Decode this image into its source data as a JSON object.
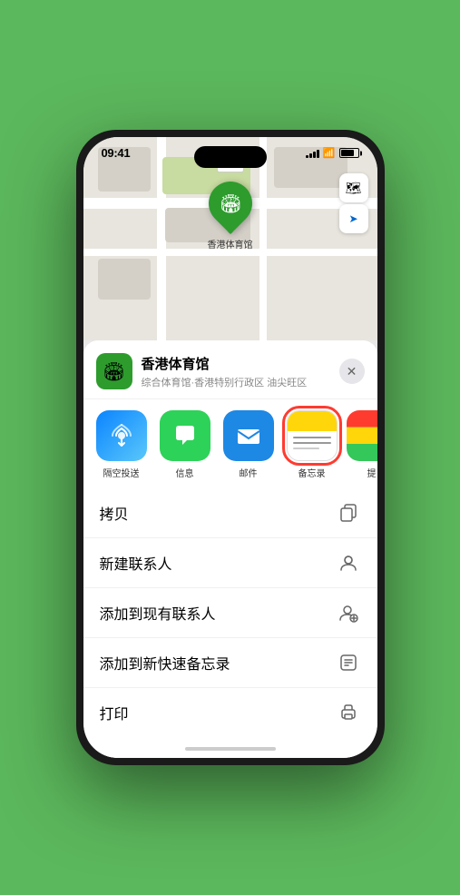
{
  "status": {
    "time": "09:41",
    "signal_bars": [
      3,
      5,
      7,
      9,
      11
    ],
    "wifi": "wifi",
    "battery": 80
  },
  "map": {
    "label": "南口",
    "pin_label": "香港体育馆",
    "map_icon": "🏟"
  },
  "map_controls": {
    "map_btn_label": "🗺",
    "location_btn_label": "➤"
  },
  "venue": {
    "name": "香港体育馆",
    "description": "综合体育馆·香港特别行政区 油尖旺区",
    "icon": "🏟",
    "close_label": "✕"
  },
  "share_items": [
    {
      "id": "airdrop",
      "label": "隔空投送",
      "icon": "📡"
    },
    {
      "id": "messages",
      "label": "信息",
      "icon": "💬"
    },
    {
      "id": "mail",
      "label": "邮件",
      "icon": "✉"
    },
    {
      "id": "notes",
      "label": "备忘录",
      "icon": "📝"
    },
    {
      "id": "more",
      "label": "提",
      "icon": "···"
    }
  ],
  "actions": [
    {
      "id": "copy",
      "label": "拷贝",
      "icon": "⎘"
    },
    {
      "id": "new-contact",
      "label": "新建联系人",
      "icon": "👤"
    },
    {
      "id": "add-existing",
      "label": "添加到现有联系人",
      "icon": "👤"
    },
    {
      "id": "add-notes",
      "label": "添加到新快速备忘录",
      "icon": "🖊"
    },
    {
      "id": "print",
      "label": "打印",
      "icon": "🖨"
    }
  ]
}
